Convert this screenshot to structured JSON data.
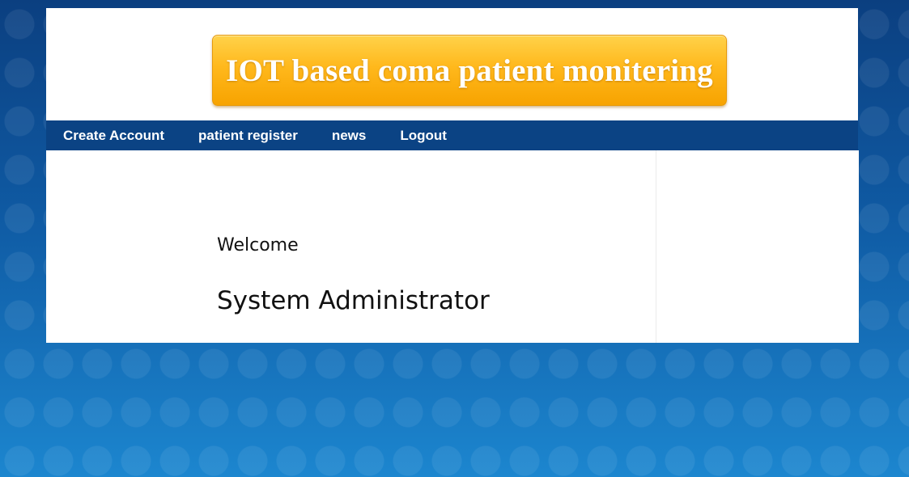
{
  "header": {
    "banner_title": "IOT based coma patient monitering"
  },
  "nav": {
    "items": [
      {
        "label": "Create Account"
      },
      {
        "label": "patient register"
      },
      {
        "label": "news"
      },
      {
        "label": "Logout"
      }
    ]
  },
  "main": {
    "welcome": "Welcome",
    "user_name": "System Administrator"
  },
  "colors": {
    "navbar": "#0b4384",
    "banner": "#ffb81c",
    "background": "#0e4f94"
  }
}
